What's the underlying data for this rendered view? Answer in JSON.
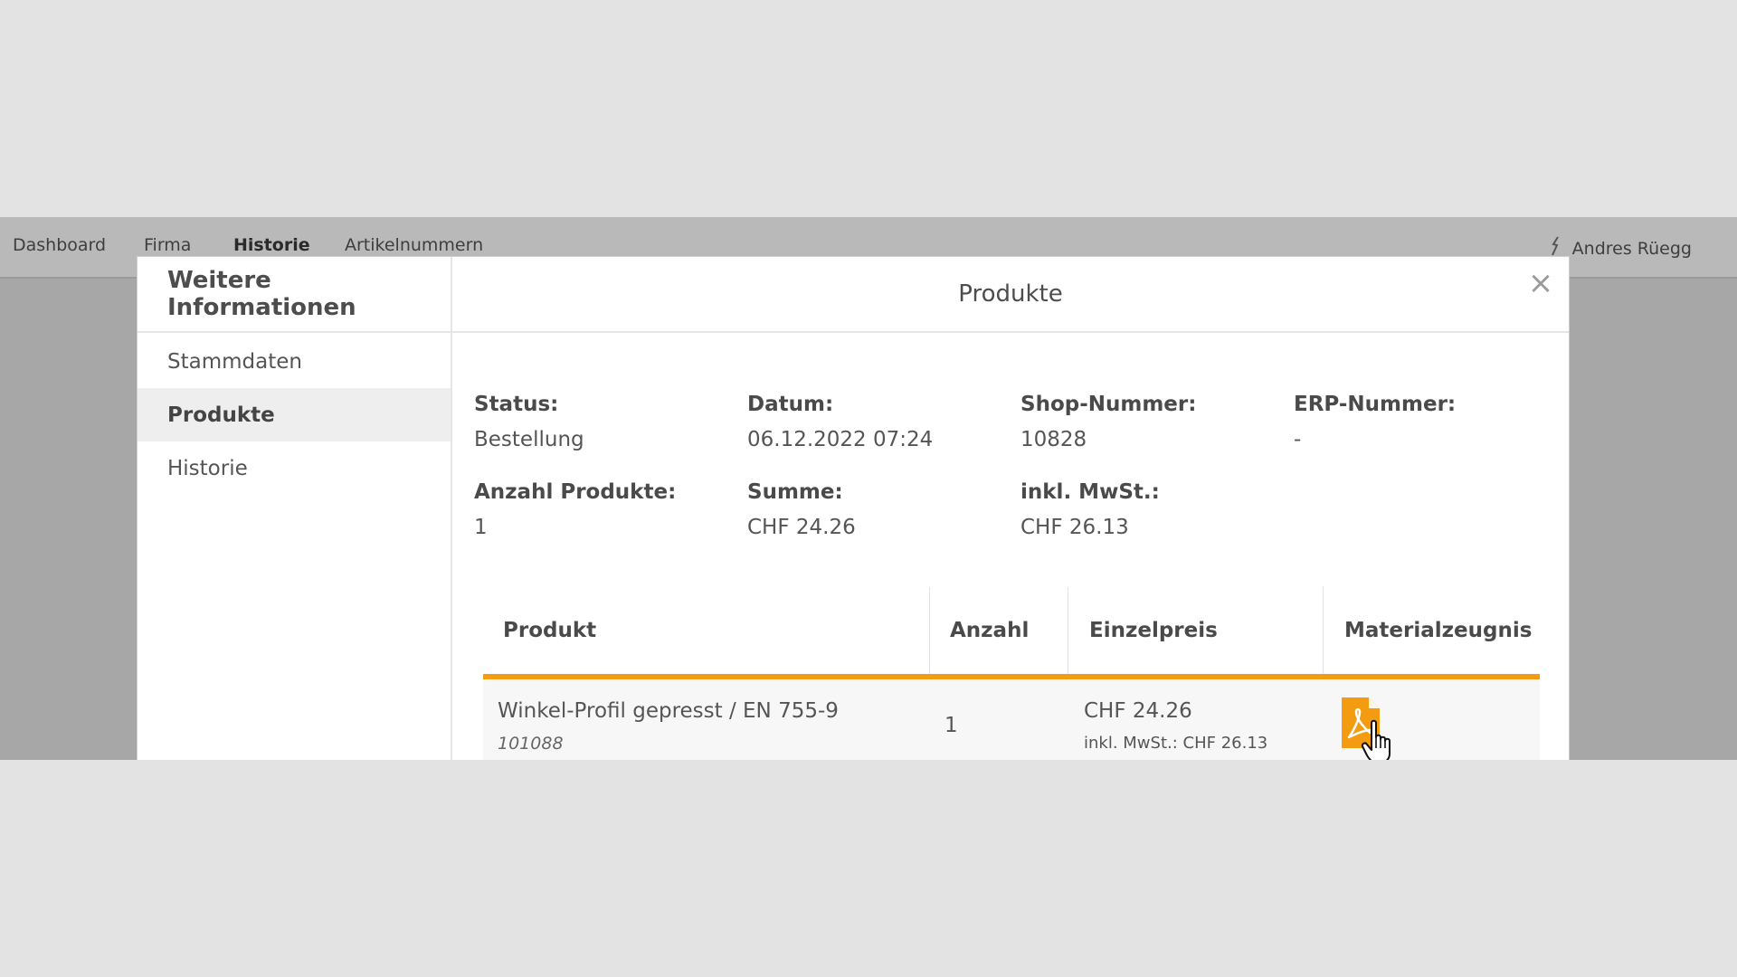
{
  "nav": {
    "items": [
      {
        "label": "Dashboard"
      },
      {
        "label": "Firma"
      },
      {
        "label": "Historie"
      },
      {
        "label": "Artikelnummern"
      }
    ],
    "user": "Andres Rüegg",
    "user_icon": "pin-icon"
  },
  "modal": {
    "side_title": "Weitere Informationen",
    "side_items": [
      {
        "label": "Stammdaten"
      },
      {
        "label": "Produkte"
      },
      {
        "label": "Historie"
      }
    ],
    "header_title": "Produkte",
    "close_icon": "×",
    "info": {
      "status_label": "Status:",
      "status_value": "Bestellung",
      "datum_label": "Datum:",
      "datum_value": "06.12.2022 07:24",
      "shop_label": "Shop-Nummer:",
      "shop_value": "10828",
      "erp_label": "ERP-Nummer:",
      "erp_value": "-",
      "anzahl_label": "Anzahl Produkte:",
      "anzahl_value": "1",
      "summe_label": "Summe:",
      "summe_value": "CHF 24.26",
      "mwst_label": "inkl. MwSt.:",
      "mwst_value": "CHF 26.13"
    },
    "table": {
      "headers": [
        "Produkt",
        "Anzahl",
        "Einzelpreis",
        "Materialzeugnis"
      ],
      "accent_color": "#f39c12",
      "rows": [
        {
          "name": "Winkel-Profil gepresst / EN 755-9",
          "number": "101088",
          "qty": "1",
          "price": "CHF 24.26",
          "price_inkl": "inkl. MwSt.: CHF 26.13",
          "document_icon": "pdf-icon"
        }
      ]
    }
  }
}
